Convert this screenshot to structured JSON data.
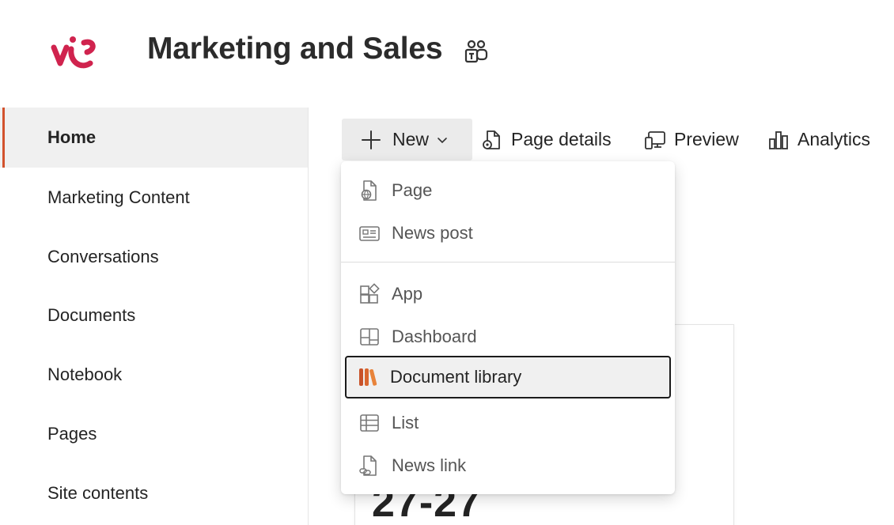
{
  "header": {
    "site_title": "Marketing and Sales",
    "logo_color": "#d0234e"
  },
  "leftnav": {
    "accent_color": "#d2522d",
    "items": [
      {
        "label": "Home",
        "selected": true
      },
      {
        "label": "Marketing Content"
      },
      {
        "label": "Conversations"
      },
      {
        "label": "Documents"
      },
      {
        "label": "Notebook"
      },
      {
        "label": "Pages"
      },
      {
        "label": "Site contents"
      }
    ]
  },
  "commandbar": {
    "new_label": "New",
    "page_details_label": "Page details",
    "preview_label": "Preview",
    "analytics_label": "Analytics"
  },
  "new_menu": {
    "items": [
      {
        "label": "Page",
        "icon": "page-globe-icon"
      },
      {
        "label": "News post",
        "icon": "news-post-icon"
      },
      {
        "label": "App",
        "icon": "app-icon"
      },
      {
        "label": "Dashboard",
        "icon": "dashboard-icon"
      },
      {
        "label": "Document library",
        "icon": "document-library-icon",
        "highlighted": true
      },
      {
        "label": "List",
        "icon": "list-icon"
      },
      {
        "label": "News link",
        "icon": "news-link-icon"
      }
    ]
  },
  "background_card": {
    "text": "27-27"
  }
}
